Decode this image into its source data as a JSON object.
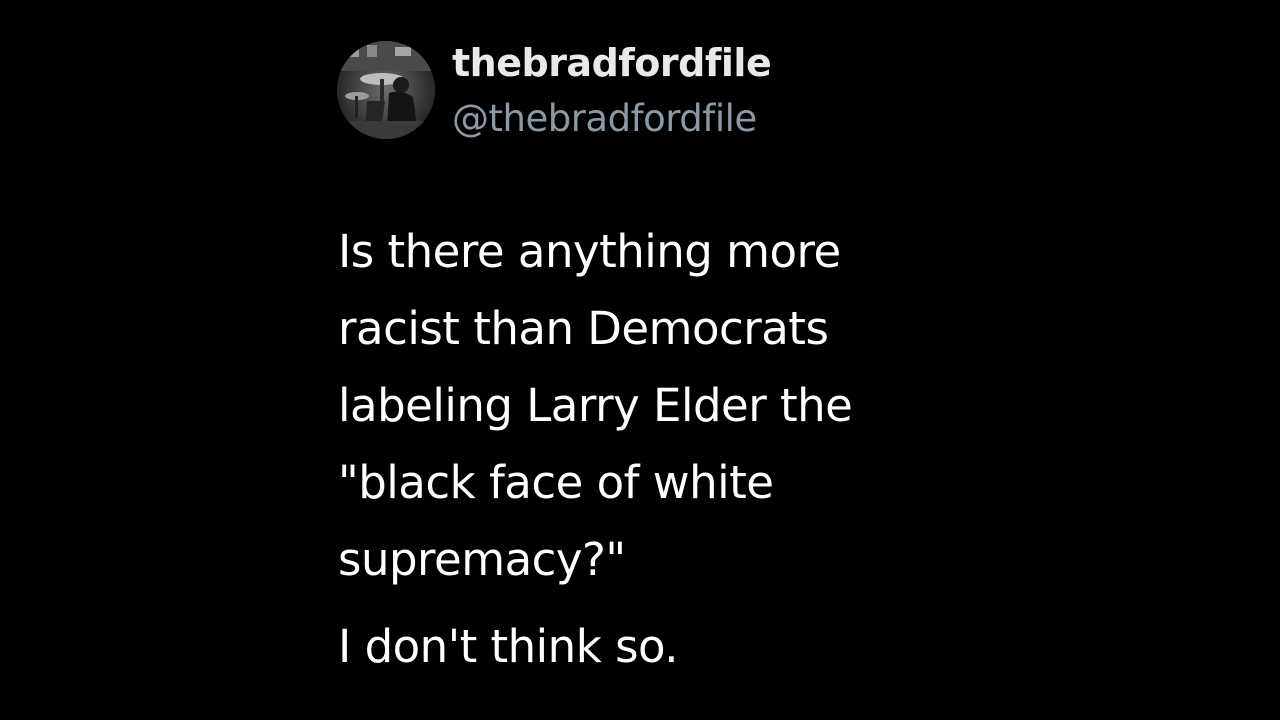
{
  "author": {
    "display_name": "thebradfordfile",
    "handle": "@thebradfordfile",
    "avatar_icon": "profile-photo-bw"
  },
  "tweet": {
    "body_lines": [
      "Is there anything more",
      "racist than Democrats",
      "labeling Larry Elder the",
      "\"black face of white",
      "supremacy?\""
    ],
    "closing": "I don't think so."
  },
  "colors": {
    "background": "#000000",
    "text_primary": "#ffffff",
    "name": "#e7e9ea",
    "handle": "#8b98a5"
  }
}
